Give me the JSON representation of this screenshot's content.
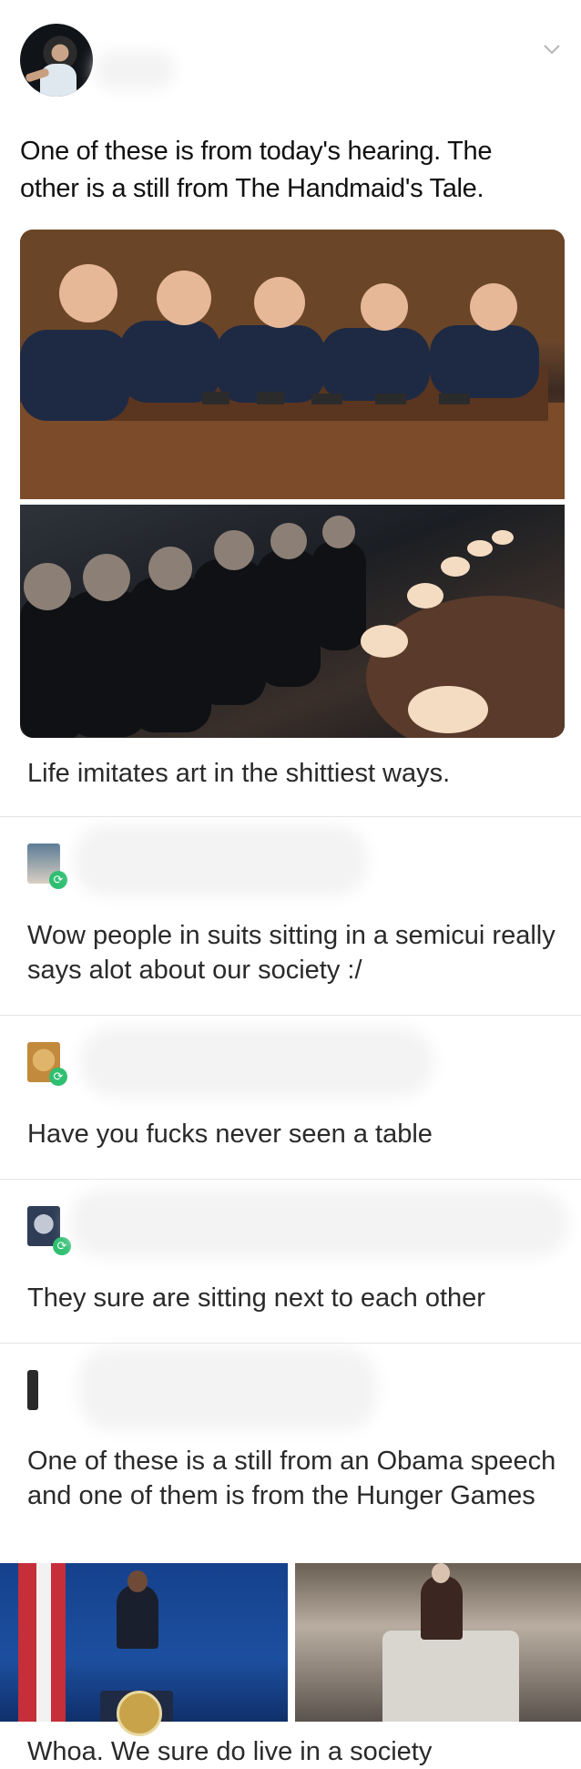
{
  "tweet": {
    "text": "One of these is from today's hearing. The other is a still from The Handmaid's Tale.",
    "photo_top_alt": "senators-at-hearing-photo",
    "photo_bottom_alt": "handmaids-tale-still-photo",
    "icons": {
      "menu": "chevron-down-icon"
    }
  },
  "replies": [
    {
      "text": "Life imitates art in the shittiest ways."
    },
    {
      "text": "Wow people in suits sitting in a semicui really says alot about our society :/"
    },
    {
      "text": "Have you fucks never seen a table"
    },
    {
      "text": "They sure are sitting next to each other"
    },
    {
      "text": "One of these is a still from an Obama speech and one of them is from the Hunger Games"
    },
    {
      "text": "Whoa. We sure do live in a society"
    }
  ],
  "colors": {
    "retweet_badge": "#2fbf71",
    "divider": "#e4e4e4"
  }
}
